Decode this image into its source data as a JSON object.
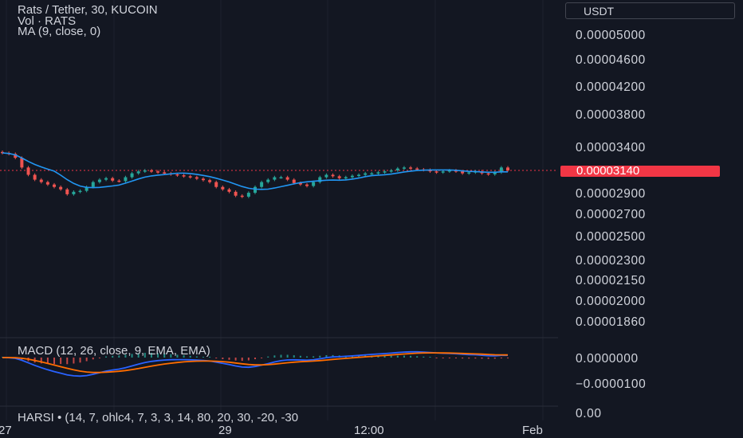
{
  "legend": {
    "symbol": "Rats / Tether, 30, KUCOIN",
    "volume": "Vol · RATS",
    "ma": "MA (9, close, 0)",
    "macd": "MACD (12, 26, close, 9, EMA, EMA)",
    "harsi": "HARSI • (14, 7, ohlc4, 7, 3, 3, 14, 80, 20, 30, -20, -30"
  },
  "currency_selector": "USDT",
  "last_price": "0.00003140",
  "price_axis": [
    "0.00005000",
    "0.00004600",
    "0.00004200",
    "0.00003800",
    "0.00003400",
    "0.00002900",
    "0.00002700",
    "0.00002500",
    "0.00002300",
    "0.00002150",
    "0.00002000",
    "0.00001860"
  ],
  "macd_axis": [
    "0.0000000",
    "−0.0000100"
  ],
  "harsi_axis": [
    "0.00"
  ],
  "time_axis": [
    "27",
    "29",
    "12:00",
    "Feb"
  ],
  "colors": {
    "background": "#131722",
    "up": "#26a69a",
    "down": "#ef5350",
    "ma": "#2196f3",
    "macd_line": "#2962ff",
    "signal_line": "#ff6d00",
    "price_tag": "#f23645"
  },
  "chart_data": {
    "type": "candlestick",
    "close_series": [
      3.5,
      3.48,
      3.4,
      3.2,
      3.05,
      2.95,
      2.9,
      2.85,
      2.8,
      2.75,
      2.65,
      2.7,
      2.72,
      2.8,
      2.9,
      2.95,
      2.98,
      2.93,
      2.92,
      3.0,
      3.08,
      3.12,
      3.14,
      3.12,
      3.1,
      3.08,
      3.06,
      3.04,
      3.02,
      3.0,
      2.97,
      2.94,
      2.9,
      2.8,
      2.75,
      2.7,
      2.62,
      2.6,
      2.68,
      2.8,
      2.9,
      2.95,
      3.0,
      3.0,
      2.95,
      2.88,
      2.85,
      2.82,
      2.9,
      3.0,
      3.05,
      3.02,
      2.98,
      3.0,
      3.03,
      3.05,
      3.08,
      3.08,
      3.1,
      3.12,
      3.14,
      3.18,
      3.2,
      3.18,
      3.16,
      3.15,
      3.12,
      3.1,
      3.12,
      3.14,
      3.12,
      3.08,
      3.1,
      3.12,
      3.08,
      3.06,
      3.1,
      3.2,
      3.14
    ],
    "last": 3.14e-05,
    "ylim": [
      1.86e-05,
      5e-05
    ]
  }
}
